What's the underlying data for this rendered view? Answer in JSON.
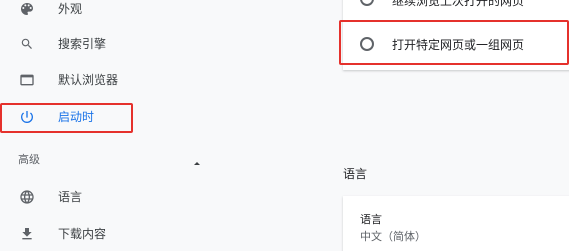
{
  "sidebar": {
    "items": [
      {
        "label": "外观",
        "icon": "palette-icon"
      },
      {
        "label": "搜索引擎",
        "icon": "search-icon"
      },
      {
        "label": "默认浏览器",
        "icon": "browser-window-icon"
      },
      {
        "label": "启动时",
        "icon": "power-icon",
        "active": true
      }
    ],
    "advanced_header": "高级",
    "advanced_items": [
      {
        "label": "语言",
        "icon": "globe-icon"
      },
      {
        "label": "下载内容",
        "icon": "download-icon"
      }
    ]
  },
  "startup": {
    "option_continue": "继续浏览上次打开的网页",
    "option_specific": "打开特定网页或一组网页"
  },
  "languages_section": {
    "title": "语言",
    "label": "语言",
    "value": "中文（简体）"
  },
  "colors": {
    "accent": "#1a73e8",
    "highlight": "#e5312c",
    "icon": "#5f6368"
  }
}
